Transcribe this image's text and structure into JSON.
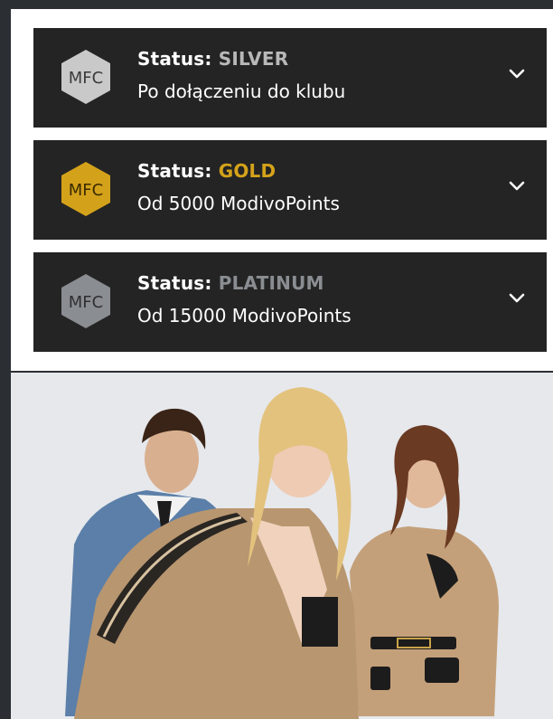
{
  "tiers": [
    {
      "label": "Status: ",
      "level": "SILVER",
      "description": "Po dołączeniu do klubu",
      "badge_text": "MFC",
      "badge_color": "#c9c9c9",
      "level_color": "#b8b8b8"
    },
    {
      "label": "Status: ",
      "level": "GOLD",
      "description": "Od 5000 ModivoPoints",
      "badge_text": "MFC",
      "badge_color": "#d4a21a",
      "level_color": "#d4a21a"
    },
    {
      "label": "Status: ",
      "level": "PLATINUM",
      "description": "Od 15000 ModivoPoints",
      "badge_text": "MFC",
      "badge_color": "#8a8d91",
      "level_color": "#8a8d91"
    }
  ],
  "icons": {
    "badge": "hexagon-badge-icon",
    "expand": "chevron-down-icon"
  },
  "colors": {
    "card_bg": "#242424",
    "page_bg": "#ffffff",
    "frame": "#2b2e33"
  }
}
